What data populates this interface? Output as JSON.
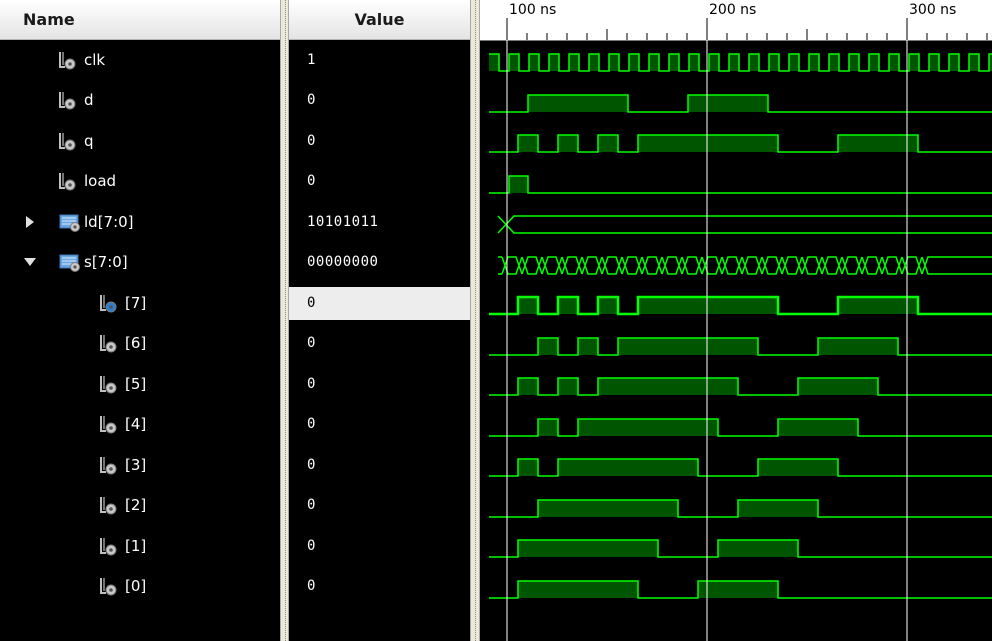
{
  "headers": {
    "name": "Name",
    "value": "Value"
  },
  "timeline": {
    "labels": [
      "100 ns",
      "200 ns",
      "300 ns"
    ]
  },
  "signals": [
    {
      "id": "clk",
      "name": "clk",
      "value": "1",
      "type": "bit",
      "indent": 0
    },
    {
      "id": "d",
      "name": "d",
      "value": "0",
      "type": "bit",
      "indent": 0
    },
    {
      "id": "q",
      "name": "q",
      "value": "0",
      "type": "bit",
      "indent": 0
    },
    {
      "id": "load",
      "name": "load",
      "value": "0",
      "type": "bit",
      "indent": 0
    },
    {
      "id": "ld",
      "name": "ld[7:0]",
      "value": "10101011",
      "type": "bus",
      "indent": 0,
      "expander": "collapsed"
    },
    {
      "id": "s",
      "name": "s[7:0]",
      "value": "00000000",
      "type": "bus",
      "indent": 0,
      "expander": "expanded"
    },
    {
      "id": "s7",
      "name": "[7]",
      "value": "0",
      "type": "bit",
      "indent": 1,
      "selected": true
    },
    {
      "id": "s6",
      "name": "[6]",
      "value": "0",
      "type": "bit",
      "indent": 1
    },
    {
      "id": "s5",
      "name": "[5]",
      "value": "0",
      "type": "bit",
      "indent": 1
    },
    {
      "id": "s4",
      "name": "[4]",
      "value": "0",
      "type": "bit",
      "indent": 1
    },
    {
      "id": "s3",
      "name": "[3]",
      "value": "0",
      "type": "bit",
      "indent": 1
    },
    {
      "id": "s2",
      "name": "[2]",
      "value": "0",
      "type": "bit",
      "indent": 1
    },
    {
      "id": "s1",
      "name": "[1]",
      "value": "0",
      "type": "bit",
      "indent": 1
    },
    {
      "id": "s0",
      "name": "[0]",
      "value": "0",
      "type": "bit",
      "indent": 1
    }
  ],
  "colors": {
    "wave": "#00ff00",
    "wave_fill": "#005500",
    "background": "#000000",
    "cursor": "#ffffff"
  }
}
